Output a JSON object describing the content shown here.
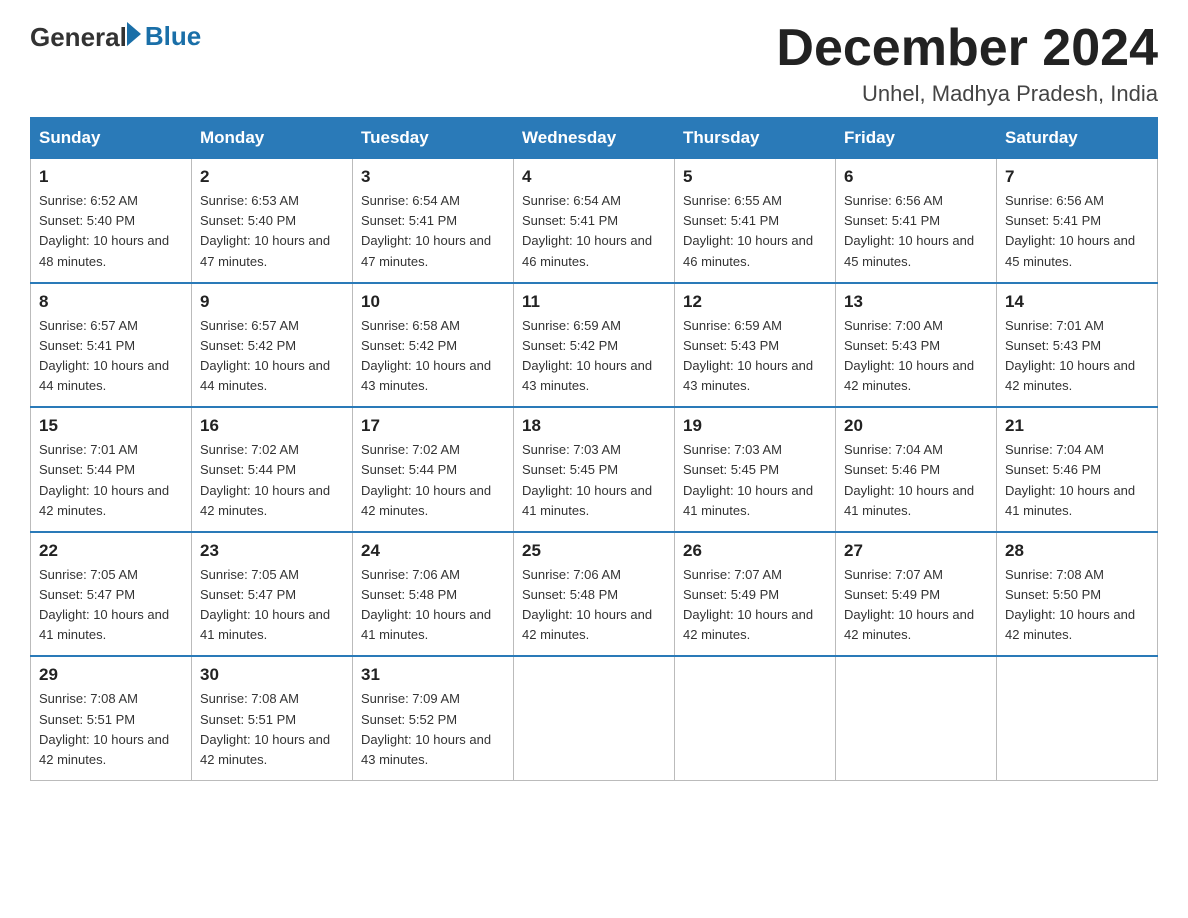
{
  "header": {
    "logo_general": "General",
    "logo_blue": "Blue",
    "month_title": "December 2024",
    "location": "Unhel, Madhya Pradesh, India"
  },
  "days_of_week": [
    "Sunday",
    "Monday",
    "Tuesday",
    "Wednesday",
    "Thursday",
    "Friday",
    "Saturday"
  ],
  "weeks": [
    [
      {
        "day": "1",
        "sunrise": "6:52 AM",
        "sunset": "5:40 PM",
        "daylight": "10 hours and 48 minutes."
      },
      {
        "day": "2",
        "sunrise": "6:53 AM",
        "sunset": "5:40 PM",
        "daylight": "10 hours and 47 minutes."
      },
      {
        "day": "3",
        "sunrise": "6:54 AM",
        "sunset": "5:41 PM",
        "daylight": "10 hours and 47 minutes."
      },
      {
        "day": "4",
        "sunrise": "6:54 AM",
        "sunset": "5:41 PM",
        "daylight": "10 hours and 46 minutes."
      },
      {
        "day": "5",
        "sunrise": "6:55 AM",
        "sunset": "5:41 PM",
        "daylight": "10 hours and 46 minutes."
      },
      {
        "day": "6",
        "sunrise": "6:56 AM",
        "sunset": "5:41 PM",
        "daylight": "10 hours and 45 minutes."
      },
      {
        "day": "7",
        "sunrise": "6:56 AM",
        "sunset": "5:41 PM",
        "daylight": "10 hours and 45 minutes."
      }
    ],
    [
      {
        "day": "8",
        "sunrise": "6:57 AM",
        "sunset": "5:41 PM",
        "daylight": "10 hours and 44 minutes."
      },
      {
        "day": "9",
        "sunrise": "6:57 AM",
        "sunset": "5:42 PM",
        "daylight": "10 hours and 44 minutes."
      },
      {
        "day": "10",
        "sunrise": "6:58 AM",
        "sunset": "5:42 PM",
        "daylight": "10 hours and 43 minutes."
      },
      {
        "day": "11",
        "sunrise": "6:59 AM",
        "sunset": "5:42 PM",
        "daylight": "10 hours and 43 minutes."
      },
      {
        "day": "12",
        "sunrise": "6:59 AM",
        "sunset": "5:43 PM",
        "daylight": "10 hours and 43 minutes."
      },
      {
        "day": "13",
        "sunrise": "7:00 AM",
        "sunset": "5:43 PM",
        "daylight": "10 hours and 42 minutes."
      },
      {
        "day": "14",
        "sunrise": "7:01 AM",
        "sunset": "5:43 PM",
        "daylight": "10 hours and 42 minutes."
      }
    ],
    [
      {
        "day": "15",
        "sunrise": "7:01 AM",
        "sunset": "5:44 PM",
        "daylight": "10 hours and 42 minutes."
      },
      {
        "day": "16",
        "sunrise": "7:02 AM",
        "sunset": "5:44 PM",
        "daylight": "10 hours and 42 minutes."
      },
      {
        "day": "17",
        "sunrise": "7:02 AM",
        "sunset": "5:44 PM",
        "daylight": "10 hours and 42 minutes."
      },
      {
        "day": "18",
        "sunrise": "7:03 AM",
        "sunset": "5:45 PM",
        "daylight": "10 hours and 41 minutes."
      },
      {
        "day": "19",
        "sunrise": "7:03 AM",
        "sunset": "5:45 PM",
        "daylight": "10 hours and 41 minutes."
      },
      {
        "day": "20",
        "sunrise": "7:04 AM",
        "sunset": "5:46 PM",
        "daylight": "10 hours and 41 minutes."
      },
      {
        "day": "21",
        "sunrise": "7:04 AM",
        "sunset": "5:46 PM",
        "daylight": "10 hours and 41 minutes."
      }
    ],
    [
      {
        "day": "22",
        "sunrise": "7:05 AM",
        "sunset": "5:47 PM",
        "daylight": "10 hours and 41 minutes."
      },
      {
        "day": "23",
        "sunrise": "7:05 AM",
        "sunset": "5:47 PM",
        "daylight": "10 hours and 41 minutes."
      },
      {
        "day": "24",
        "sunrise": "7:06 AM",
        "sunset": "5:48 PM",
        "daylight": "10 hours and 41 minutes."
      },
      {
        "day": "25",
        "sunrise": "7:06 AM",
        "sunset": "5:48 PM",
        "daylight": "10 hours and 42 minutes."
      },
      {
        "day": "26",
        "sunrise": "7:07 AM",
        "sunset": "5:49 PM",
        "daylight": "10 hours and 42 minutes."
      },
      {
        "day": "27",
        "sunrise": "7:07 AM",
        "sunset": "5:49 PM",
        "daylight": "10 hours and 42 minutes."
      },
      {
        "day": "28",
        "sunrise": "7:08 AM",
        "sunset": "5:50 PM",
        "daylight": "10 hours and 42 minutes."
      }
    ],
    [
      {
        "day": "29",
        "sunrise": "7:08 AM",
        "sunset": "5:51 PM",
        "daylight": "10 hours and 42 minutes."
      },
      {
        "day": "30",
        "sunrise": "7:08 AM",
        "sunset": "5:51 PM",
        "daylight": "10 hours and 42 minutes."
      },
      {
        "day": "31",
        "sunrise": "7:09 AM",
        "sunset": "5:52 PM",
        "daylight": "10 hours and 43 minutes."
      },
      null,
      null,
      null,
      null
    ]
  ],
  "labels": {
    "sunrise_prefix": "Sunrise: ",
    "sunset_prefix": "Sunset: ",
    "daylight_prefix": "Daylight: "
  }
}
